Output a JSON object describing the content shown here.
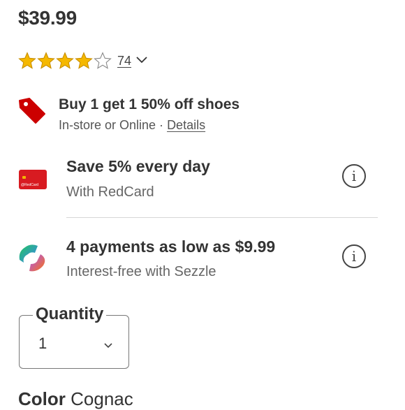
{
  "product": {
    "price": "$39.99"
  },
  "rating": {
    "stars": 4,
    "max_stars": 5,
    "count": "74"
  },
  "promo": {
    "title": "Buy 1 get 1 50% off shoes",
    "channel": "In-store or Online · ",
    "details_link": "Details",
    "icon": "price-tag-icon",
    "color": "#cc0000"
  },
  "redcard": {
    "title": "Save 5% every day",
    "subtitle": "With RedCard",
    "card_label": "@RedCard",
    "card_color": "#d81b21"
  },
  "sezzle": {
    "title": "4 payments as low as $9.99",
    "subtitle": "Interest-free with Sezzle",
    "icon": "sezzle-logo-icon"
  },
  "quantity": {
    "label": "Quantity",
    "value": "1"
  },
  "color": {
    "label": "Color",
    "value": "Cognac"
  }
}
